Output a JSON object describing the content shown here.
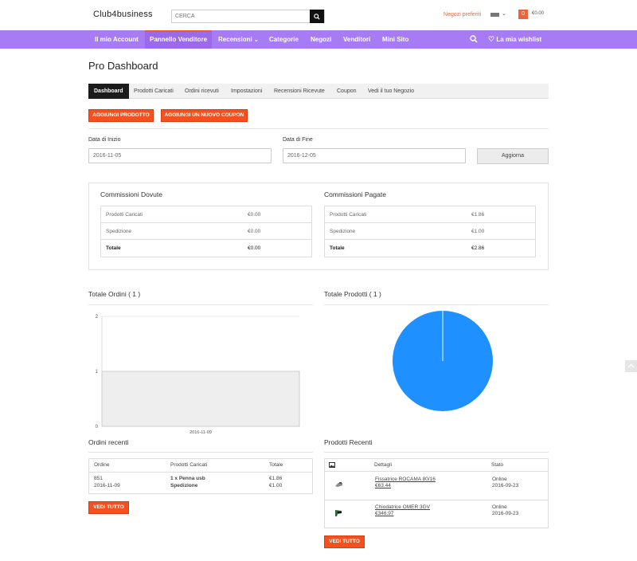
{
  "header": {
    "logo": "Club4business",
    "search_placeholder": "CERCA",
    "favorites_label": "Negozi preferiti",
    "cart_count": "0",
    "cart_total": "€0.00"
  },
  "nav": {
    "items": [
      {
        "label": "Il mio Account"
      },
      {
        "label": "Pannello Venditore"
      },
      {
        "label": "Recensioni"
      },
      {
        "label": "Categorie"
      },
      {
        "label": "Negozi"
      },
      {
        "label": "Venditori"
      },
      {
        "label": "Mini Sito"
      }
    ],
    "wishlist_label": "La mia wishlist"
  },
  "page": {
    "title": "Pro Dashboard",
    "tabs": [
      {
        "label": "Dashboard"
      },
      {
        "label": "Prodotti Caricati"
      },
      {
        "label": "Ordini ricevuti"
      },
      {
        "label": "Impostazioni"
      },
      {
        "label": "Recensioni Ricevute"
      },
      {
        "label": "Coupon"
      },
      {
        "label": "Vedi il tuo Negozio"
      }
    ],
    "add_product_button": "AGGIUNGI PRODOTTO",
    "add_coupon_button": "AGGIUNGI UN NUOVO COUPON",
    "filters": {
      "start_label": "Data di Inizio",
      "start_value": "2016-11-05",
      "end_label": "Data di Fine",
      "end_value": "2016-12-05",
      "update_button": "Aggiorna"
    },
    "commissions_due": {
      "title": "Commissioni Dovute",
      "rows": [
        {
          "label": "Prodotti Caricati",
          "value": "€0.00"
        },
        {
          "label": "Spedizione",
          "value": "€0.00"
        },
        {
          "label": "Totale",
          "value": "€0.00"
        }
      ]
    },
    "commissions_paid": {
      "title": "Commissioni Pagate",
      "rows": [
        {
          "label": "Prodotti Caricati",
          "value": "€1.86"
        },
        {
          "label": "Spedizione",
          "value": "€1.00"
        },
        {
          "label": "Totale",
          "value": "€2.86"
        }
      ]
    },
    "total_orders_title": "Totale Ordini ( 1 )",
    "total_products_title": "Totale Prodotti ( 1 )",
    "recent_orders": {
      "title": "Ordini recenti",
      "headers": [
        "Ordine",
        "Prodotti Caricati",
        "Totale"
      ],
      "order_id": "851",
      "order_date": "2016-11-09",
      "product_line": "1 x Penna usb",
      "shipping_line": "Spedizione",
      "product_total": "€1.86",
      "shipping_total": "€1.00",
      "view_all": "VEDI TUTTO"
    },
    "recent_products": {
      "title": "Prodotti Recenti",
      "headers": [
        "Dettagli",
        "Stato"
      ],
      "items": [
        {
          "name": "Fissatrice ROCAMA 80/16",
          "price": "€63.44",
          "status": "Online",
          "date": "2016-09-23"
        },
        {
          "name": "Chiodatrice OMER 3GV",
          "price": "€346.97",
          "status": "Online",
          "date": "2016-09-23"
        }
      ],
      "view_all": "VEDI TUTTO"
    }
  },
  "chart_data": [
    {
      "type": "bar",
      "categories": [
        "2016-11-09"
      ],
      "values": [
        1
      ],
      "ylim": [
        0,
        2
      ],
      "yticks": [
        "2",
        "1",
        "0"
      ],
      "grid": true,
      "colors": {
        "bar": "#eeeeee",
        "bar_border": "#cccccc"
      }
    },
    {
      "type": "pie",
      "labels": [
        ""
      ],
      "values": [
        1
      ],
      "colors": [
        "#1e90ff"
      ]
    }
  ],
  "colors": {
    "nav_bg": "#a77bf3",
    "accent": "#f4511e",
    "link_red": "#f0633a"
  }
}
